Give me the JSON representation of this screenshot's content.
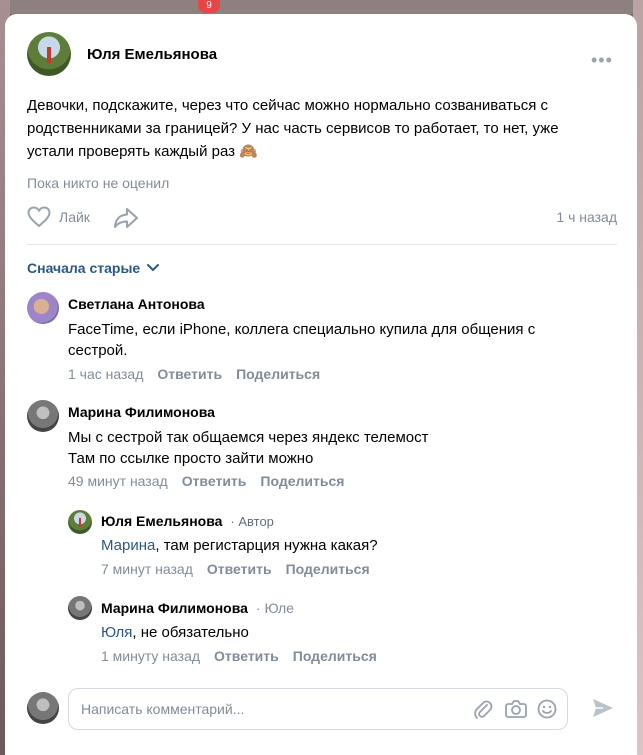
{
  "top_bar": {
    "notification_count": "9"
  },
  "post": {
    "author": "Юля Емельянова",
    "more_label": "•••",
    "text": "Девочки, подскажите, через что сейчас можно нормально созваниваться с родственниками за границей? У нас часть сервисов то работает, то нет, уже устали проверять каждый раз",
    "emoji": "🙈",
    "likes_status": "Пока никто не оценил",
    "like_label": "Лайк",
    "time": "1 ч назад"
  },
  "sort": {
    "label": "Сначала старые"
  },
  "comments": [
    {
      "author": "Светлана Антонова",
      "text": "FaceTime, если iPhone, коллега специально купила для общения с сестрой.",
      "time": "1 час назад",
      "reply": "Ответить",
      "share": "Поделиться"
    },
    {
      "author": "Марина Филимонова",
      "text_line1": "Мы с сестрой так общаемся через яндекс телемост",
      "text_line2": "Там по ссылке просто зайти можно",
      "time": "49 минут назад",
      "reply": "Ответить",
      "share": "Поделиться"
    }
  ],
  "replies": [
    {
      "author": "Юля Емельянова",
      "badge": "· Автор",
      "mention": "Марина",
      "text": ", там регистарция нужна какая?",
      "time": "7 минут назад",
      "reply": "Ответить",
      "share": "Поделиться"
    },
    {
      "author": "Марина Филимонова",
      "reply_to": "· Юле",
      "mention": "Юля",
      "text": ", не обязательно",
      "time": "1 минуту назад",
      "reply": "Ответить",
      "share": "Поделиться"
    }
  ],
  "composer": {
    "placeholder": "Написать комментарий..."
  },
  "colors": {
    "link": "#2a5885",
    "muted": "#818c99",
    "icon": "#99a2ad"
  }
}
